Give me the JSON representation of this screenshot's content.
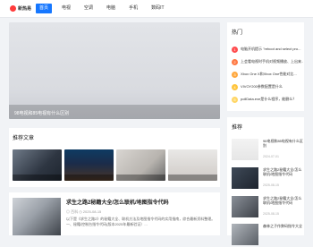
{
  "header": {
    "logo_text": "新热易",
    "nav": [
      "首页",
      "电视",
      "空调",
      "电脑",
      "手机",
      "数码IT"
    ]
  },
  "hero": {
    "caption": "98电视和85电视有什么区别"
  },
  "recommend_section": {
    "title": "推荐文章"
  },
  "article": {
    "title": "求生之路2秘籍大全/怎么联机/地图指令代码",
    "meta": "◎ 百科  ◷ 2025-08-15",
    "summary": "以下是《求生之路2》的秘籍大全、联机方法及地图指令代码的实用指南，综合最新资料整理。一、秘籍/控制台指令代码(版本2025年最新验证）..."
  },
  "hot": {
    "title": "热门",
    "items": [
      {
        "rank": "1",
        "text": "电脑开机提示 \"reboot and select pro...",
        "color": "#ff4d4f"
      },
      {
        "rank": "2",
        "text": "上会看电视时手机对视频播放、上出来...",
        "color": "#ff7a45"
      },
      {
        "rank": "3",
        "text": "Xbox One X和Xbox One性能对比...",
        "color": "#ffa940"
      },
      {
        "rank": "4",
        "text": "VIVOY200参数配置是什么",
        "color": "#ffc53d"
      },
      {
        "rank": "5",
        "text": "pollData.exe是什么程序，能删么？",
        "color": "#ffd666"
      }
    ]
  },
  "sidebar_recommend": {
    "title": "推荐",
    "items": [
      {
        "text": "98电视和85电视有什么区别",
        "date": "2024-07-01"
      },
      {
        "text": "求生之路2秘籍大全/怎么联机/地图指令代码",
        "date": "2025-08-15"
      },
      {
        "text": "求生之路2秘籍大全/怎么联机/地图指令代码",
        "date": "2025-08-15"
      },
      {
        "text": "森林之子作弊码指令大全",
        "date": ""
      }
    ]
  }
}
